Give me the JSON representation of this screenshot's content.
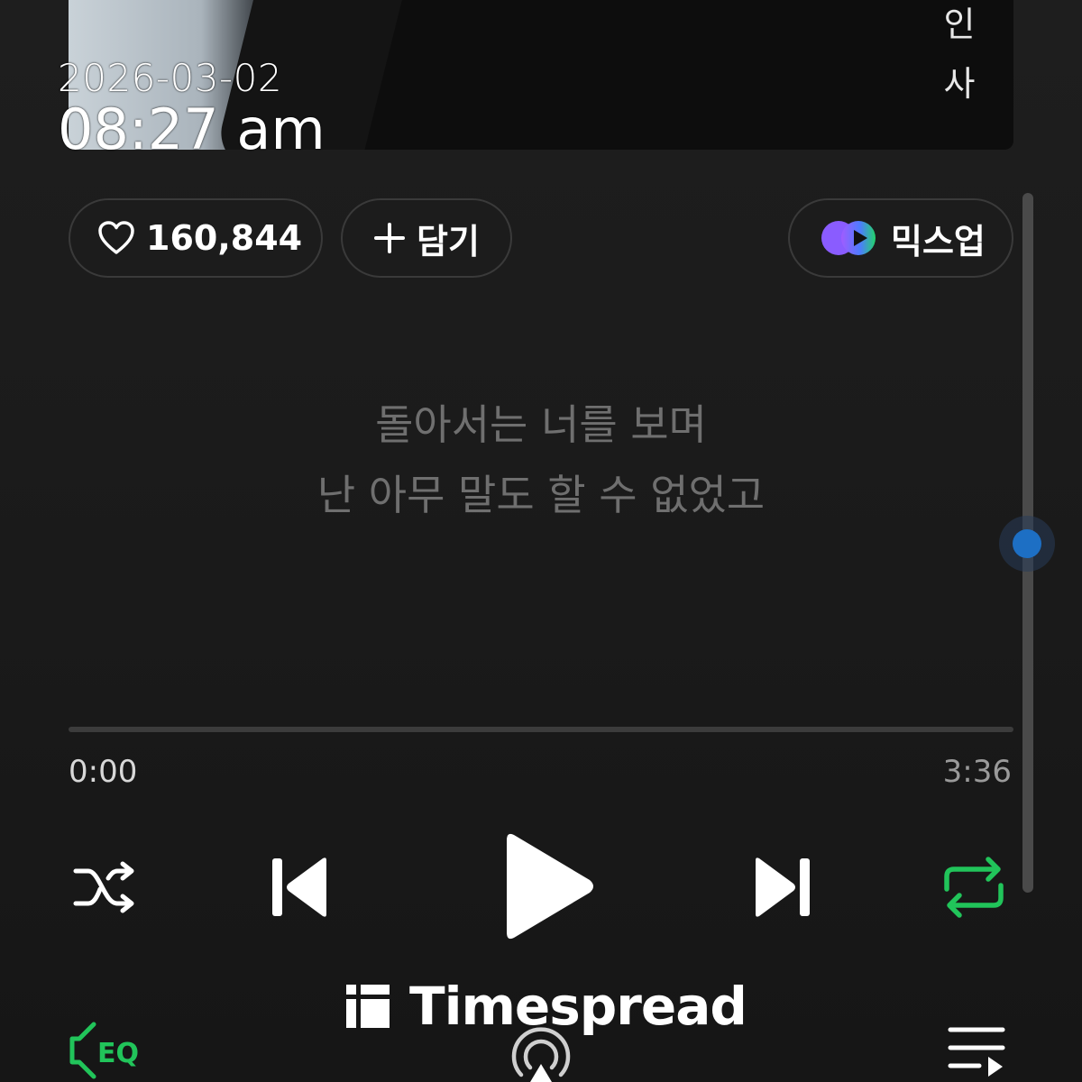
{
  "album": {
    "side_text": [
      "인",
      "사"
    ]
  },
  "clock": {
    "date": "2026-03-02",
    "time": "08:27 am"
  },
  "actions": {
    "like_count": "160,844",
    "add_label": "담기",
    "mixup_label": "믹스업"
  },
  "lyrics": {
    "line1": "돌아서는 너를 보며",
    "line2": "난 아무 말도 할 수 없었고"
  },
  "player": {
    "current_time": "0:00",
    "total_time": "3:36",
    "progress": 0,
    "repeat_active": true,
    "accent_color": "#21c45a",
    "scroll_accent": "#1d6fc4"
  },
  "bottom": {
    "eq_label": "EQ",
    "icons": [
      "eq-icon",
      "airplay-icon",
      "playlist-icon"
    ]
  },
  "watermark": {
    "text": "Timespread"
  }
}
